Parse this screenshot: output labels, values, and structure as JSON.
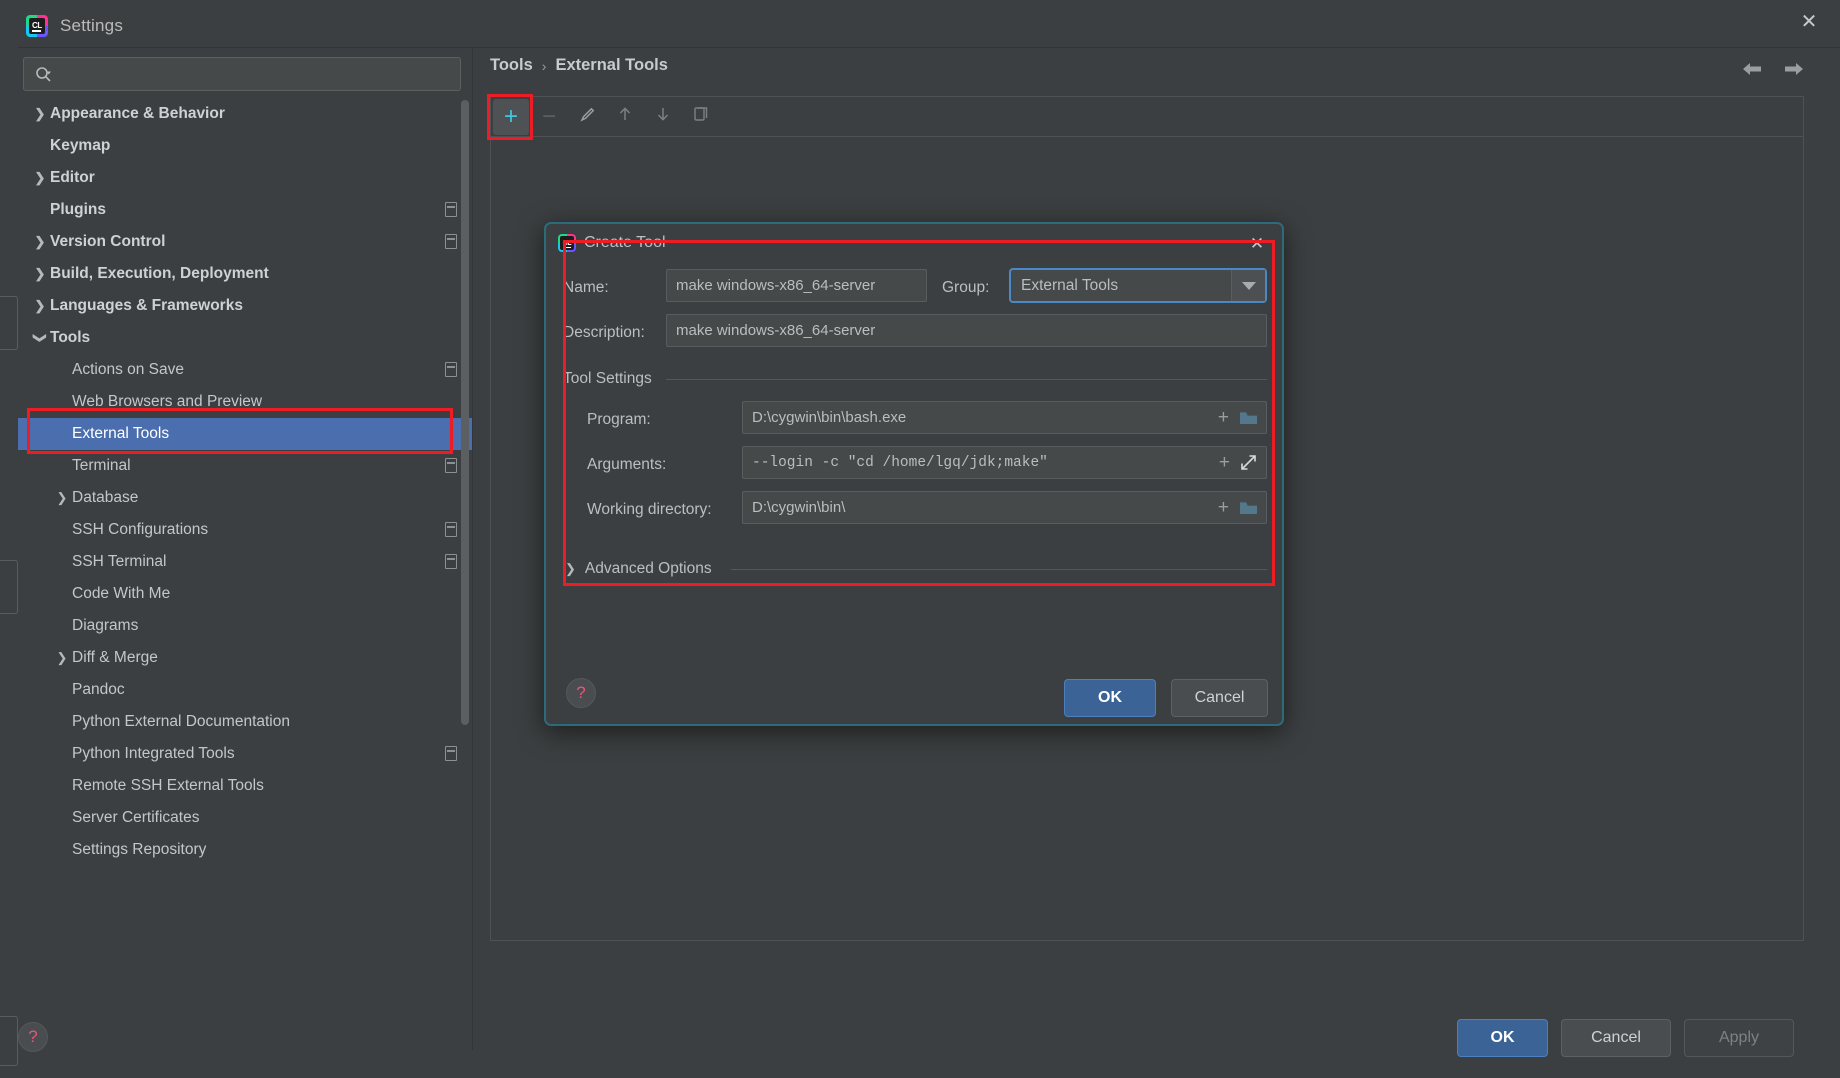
{
  "window": {
    "title": "Settings",
    "app_icon": "clion-icon",
    "close_icon": "close-icon"
  },
  "search": {
    "value": "",
    "placeholder": "",
    "icon": "search-icon"
  },
  "sidebar": {
    "items": [
      {
        "label": "Appearance & Behavior",
        "level": 0,
        "chev": "right",
        "bold": true,
        "badge": false,
        "selected": false
      },
      {
        "label": "Keymap",
        "level": 0,
        "chev": "none",
        "bold": true,
        "badge": false,
        "selected": false
      },
      {
        "label": "Editor",
        "level": 0,
        "chev": "right",
        "bold": true,
        "badge": false,
        "selected": false
      },
      {
        "label": "Plugins",
        "level": 0,
        "chev": "none",
        "bold": true,
        "badge": true,
        "selected": false
      },
      {
        "label": "Version Control",
        "level": 0,
        "chev": "right",
        "bold": true,
        "badge": true,
        "selected": false
      },
      {
        "label": "Build, Execution, Deployment",
        "level": 0,
        "chev": "right",
        "bold": true,
        "badge": false,
        "selected": false
      },
      {
        "label": "Languages & Frameworks",
        "level": 0,
        "chev": "right",
        "bold": true,
        "badge": false,
        "selected": false
      },
      {
        "label": "Tools",
        "level": 0,
        "chev": "down",
        "bold": true,
        "badge": false,
        "selected": false
      },
      {
        "label": "Actions on Save",
        "level": 1,
        "chev": "none",
        "bold": false,
        "badge": true,
        "selected": false
      },
      {
        "label": "Web Browsers and Preview",
        "level": 1,
        "chev": "none",
        "bold": false,
        "badge": false,
        "selected": false
      },
      {
        "label": "External Tools",
        "level": 1,
        "chev": "none",
        "bold": false,
        "badge": false,
        "selected": true
      },
      {
        "label": "Terminal",
        "level": 1,
        "chev": "none",
        "bold": false,
        "badge": true,
        "selected": false
      },
      {
        "label": "Database",
        "level": 1,
        "chev": "right",
        "bold": false,
        "badge": false,
        "selected": false
      },
      {
        "label": "SSH Configurations",
        "level": 1,
        "chev": "none",
        "bold": false,
        "badge": true,
        "selected": false
      },
      {
        "label": "SSH Terminal",
        "level": 1,
        "chev": "none",
        "bold": false,
        "badge": true,
        "selected": false
      },
      {
        "label": "Code With Me",
        "level": 1,
        "chev": "none",
        "bold": false,
        "badge": false,
        "selected": false
      },
      {
        "label": "Diagrams",
        "level": 1,
        "chev": "none",
        "bold": false,
        "badge": false,
        "selected": false
      },
      {
        "label": "Diff & Merge",
        "level": 1,
        "chev": "right",
        "bold": false,
        "badge": false,
        "selected": false
      },
      {
        "label": "Pandoc",
        "level": 1,
        "chev": "none",
        "bold": false,
        "badge": false,
        "selected": false
      },
      {
        "label": "Python External Documentation",
        "level": 1,
        "chev": "none",
        "bold": false,
        "badge": false,
        "selected": false
      },
      {
        "label": "Python Integrated Tools",
        "level": 1,
        "chev": "none",
        "bold": false,
        "badge": true,
        "selected": false
      },
      {
        "label": "Remote SSH External Tools",
        "level": 1,
        "chev": "none",
        "bold": false,
        "badge": false,
        "selected": false
      },
      {
        "label": "Server Certificates",
        "level": 1,
        "chev": "none",
        "bold": false,
        "badge": false,
        "selected": false
      },
      {
        "label": "Settings Repository",
        "level": 1,
        "chev": "none",
        "bold": false,
        "badge": false,
        "selected": false
      }
    ]
  },
  "content": {
    "breadcrumb": {
      "parent": "Tools",
      "separator": "›",
      "current": "External Tools"
    },
    "nav": {
      "back_icon": "arrow-left-icon",
      "forward_icon": "arrow-right-icon"
    },
    "toolbar": {
      "add_label": "+",
      "remove_label": "−",
      "edit_icon": "pencil-icon",
      "move_up_icon": "arrow-up-icon",
      "move_down_icon": "arrow-down-icon",
      "copy_icon": "copy-icon"
    }
  },
  "dialog": {
    "title": "Create Tool",
    "app_icon": "clion-icon",
    "close_icon": "close-icon",
    "name": {
      "label": "Name:",
      "value": "make windows-x86_64-server"
    },
    "group": {
      "label": "Group:",
      "value": "External Tools",
      "arrow_icon": "chevron-down-icon"
    },
    "description": {
      "label": "Description:",
      "value": "make windows-x86_64-server"
    },
    "tool_settings": {
      "legend": "Tool Settings"
    },
    "program": {
      "label": "Program:",
      "value": "D:\\cygwin\\bin\\bash.exe",
      "insert_icon": "plus-icon",
      "browse_icon": "folder-icon"
    },
    "arguments": {
      "label": "Arguments:",
      "value": "--login -c \"cd /home/lgq/jdk;make\"",
      "insert_icon": "plus-icon",
      "expand_icon": "expand-icon"
    },
    "working_directory": {
      "label": "Working directory:",
      "value": "D:\\cygwin\\bin\\",
      "insert_icon": "plus-icon",
      "browse_icon": "folder-icon"
    },
    "advanced_options": {
      "label": "Advanced Options",
      "chev": "right"
    },
    "help_icon": "help-icon",
    "ok_label": "OK",
    "cancel_label": "Cancel"
  },
  "footer": {
    "help_icon": "help-icon",
    "ok_label": "OK",
    "cancel_label": "Cancel",
    "apply_label": "Apply",
    "apply_disabled": true
  },
  "colors": {
    "accent_blue": "#3c6396",
    "selection_blue": "#4b6eaf",
    "annotation_red": "#ee1c24",
    "toolbar_plus_cyan": "#3ec9e0",
    "dialog_border_teal": "#2c6b79",
    "help_pink": "#e8547c"
  }
}
